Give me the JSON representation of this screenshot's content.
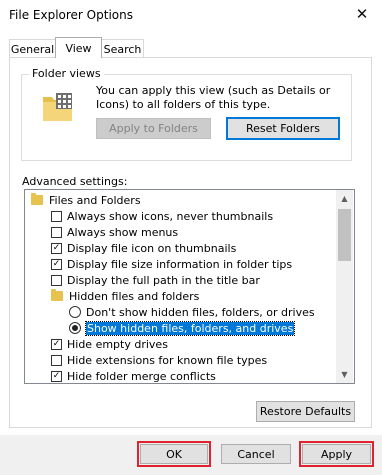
{
  "window": {
    "title": "File Explorer Options",
    "close_glyph": "✕"
  },
  "tabs": [
    {
      "label": "General"
    },
    {
      "label": "View"
    },
    {
      "label": "Search"
    }
  ],
  "folder_views": {
    "group_label": "Folder views",
    "description": "You can apply this view (such as Details or Icons) to all folders of this type.",
    "apply_button": "Apply to Folders",
    "reset_button": "Reset Folders"
  },
  "advanced": {
    "label": "Advanced settings:",
    "items": [
      {
        "type": "folder",
        "label": "Files and Folders"
      },
      {
        "type": "checkbox",
        "label": "Always show icons, never thumbnails",
        "checked": false
      },
      {
        "type": "checkbox",
        "label": "Always show menus",
        "checked": false
      },
      {
        "type": "checkbox",
        "label": "Display file icon on thumbnails",
        "checked": true
      },
      {
        "type": "checkbox",
        "label": "Display file size information in folder tips",
        "checked": true
      },
      {
        "type": "checkbox",
        "label": "Display the full path in the title bar",
        "checked": false
      },
      {
        "type": "folder",
        "label": "Hidden files and folders"
      },
      {
        "type": "radio",
        "label": "Don't show hidden files, folders, or drives",
        "checked": false
      },
      {
        "type": "radio",
        "label": "Show hidden files, folders, and drives",
        "checked": true
      },
      {
        "type": "checkbox",
        "label": "Hide empty drives",
        "checked": true
      },
      {
        "type": "checkbox",
        "label": "Hide extensions for known file types",
        "checked": false
      },
      {
        "type": "checkbox",
        "label": "Hide folder merge conflicts",
        "checked": true
      }
    ],
    "restore_button": "Restore Defaults"
  },
  "footer": {
    "ok": "OK",
    "cancel": "Cancel",
    "apply": "Apply"
  },
  "colors": {
    "highlight": "#0078d7",
    "annotation_red": "#e0242f"
  }
}
